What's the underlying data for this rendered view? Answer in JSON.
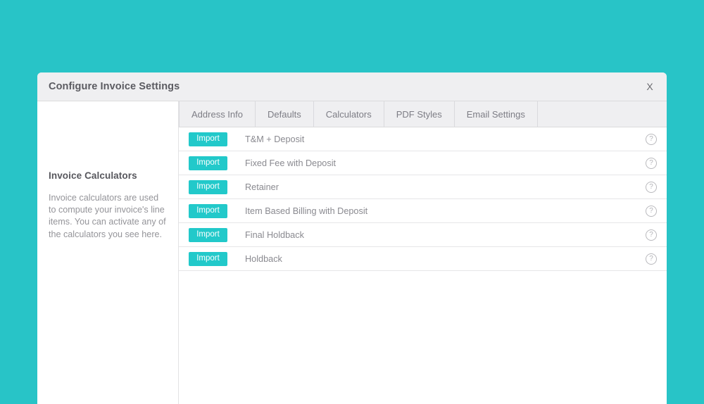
{
  "window": {
    "title": "Configure Invoice Settings",
    "close_label": "X",
    "background_color": "#28c4c7",
    "accent_color": "#22c9ca"
  },
  "sidebar": {
    "heading": "Invoice Calculators",
    "description": "Invoice calculators are used to compute your invoice's line items. You can activate any of the calculators you see here."
  },
  "tabs": [
    {
      "label": "Address Info",
      "name": "tab-address-info"
    },
    {
      "label": "Defaults",
      "name": "tab-defaults"
    },
    {
      "label": "Calculators",
      "name": "tab-calculators"
    },
    {
      "label": "PDF Styles",
      "name": "tab-pdf-styles"
    },
    {
      "label": "Email Settings",
      "name": "tab-email-settings"
    }
  ],
  "calculators": {
    "import_label": "Import",
    "help_label": "?",
    "rows": [
      {
        "name": "T&M + Deposit"
      },
      {
        "name": "Fixed Fee with Deposit"
      },
      {
        "name": "Retainer"
      },
      {
        "name": "Item Based Billing with Deposit"
      },
      {
        "name": "Final Holdback"
      },
      {
        "name": "Holdback"
      }
    ]
  }
}
